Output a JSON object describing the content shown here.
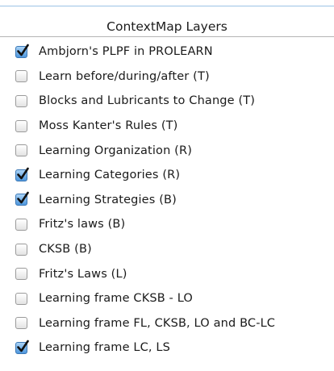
{
  "panel": {
    "title": "ContextMap Layers"
  },
  "layers": [
    {
      "label": "Ambjorn's PLPF in PROLEARN",
      "checked": true
    },
    {
      "label": "Learn before/during/after (T)",
      "checked": false
    },
    {
      "label": "Blocks and Lubricants to Change (T)",
      "checked": false
    },
    {
      "label": "Moss Kanter's Rules (T)",
      "checked": false
    },
    {
      "label": "Learning Organization (R)",
      "checked": false
    },
    {
      "label": "Learning Categories (R)",
      "checked": true
    },
    {
      "label": "Learning Strategies (B)",
      "checked": true
    },
    {
      "label": "Fritz's laws (B)",
      "checked": false
    },
    {
      "label": "CKSB (B)",
      "checked": false
    },
    {
      "label": "Fritz's Laws (L)",
      "checked": false
    },
    {
      "label": "Learning frame CKSB - LO",
      "checked": false
    },
    {
      "label": "Learning frame FL, CKSB, LO and BC-LC",
      "checked": false
    },
    {
      "label": "Learning frame LC, LS",
      "checked": true
    }
  ],
  "colors": {
    "checkbox_checked": "#4e97dd",
    "checkmark": "#111111"
  },
  "icons": {
    "checked": "checkmark-icon"
  }
}
